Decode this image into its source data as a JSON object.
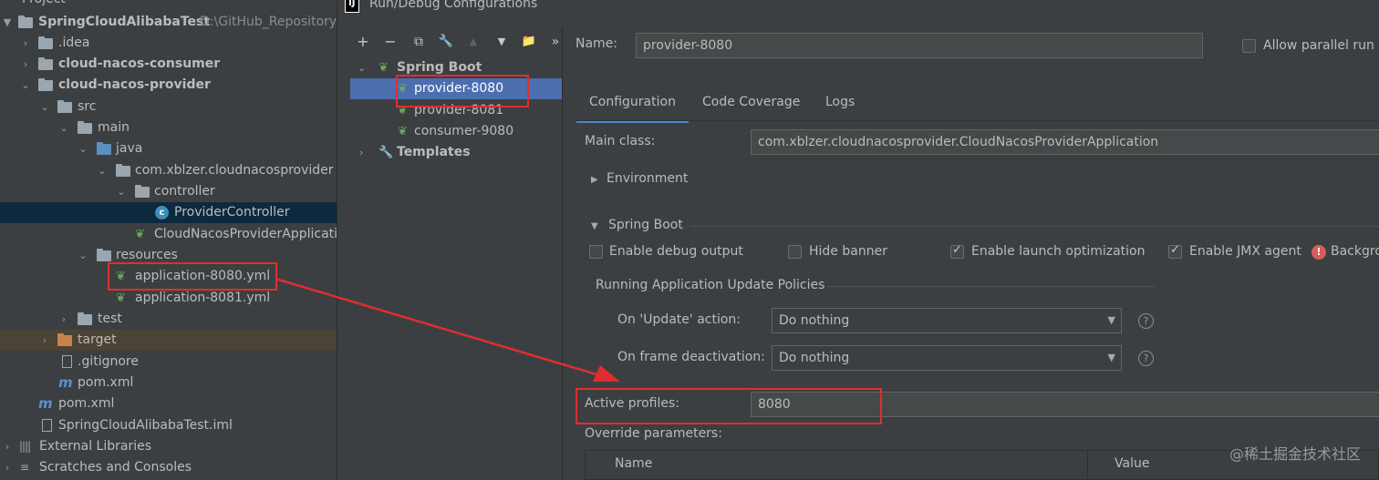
{
  "project_panel": {
    "header": "Project",
    "rows": [
      {
        "label": "SpringCloudAlibabaTest",
        "suffix": "D:\\GitHub_Repository"
      },
      {
        "label": ".idea"
      },
      {
        "label": "cloud-nacos-consumer"
      },
      {
        "label": "cloud-nacos-provider"
      },
      {
        "label": "src"
      },
      {
        "label": "main"
      },
      {
        "label": "java"
      },
      {
        "label": "com.xblzer.cloudnacosprovider"
      },
      {
        "label": "controller"
      },
      {
        "label": "ProviderController"
      },
      {
        "label": "CloudNacosProviderApplicati"
      },
      {
        "label": "resources"
      },
      {
        "label": "application-8080.yml"
      },
      {
        "label": "application-8081.yml"
      },
      {
        "label": "test"
      },
      {
        "label": "target"
      },
      {
        "label": ".gitignore"
      },
      {
        "label": "pom.xml"
      },
      {
        "label": "pom.xml"
      },
      {
        "label": "SpringCloudAlibabaTest.iml"
      },
      {
        "label": "External Libraries"
      },
      {
        "label": "Scratches and Consoles"
      }
    ],
    "icon_letters": {
      "class": "c",
      "maven": "m"
    }
  },
  "dialog": {
    "title": "Run/Debug Configurations",
    "logo_text": "IJ",
    "toolbar": {
      "add": "+",
      "remove": "−",
      "copy": "⧉",
      "wrench": "🔧",
      "up": "▲",
      "down": "▼",
      "folder": "📁",
      "more": "»"
    },
    "config_tree": {
      "group": "Spring Boot",
      "items": [
        "provider-8080",
        "provider-8081",
        "consumer-9080"
      ],
      "templates": "Templates"
    },
    "name_label": "Name:",
    "name_value": "provider-8080",
    "allow_parallel": "Allow parallel run",
    "tabs": [
      "Configuration",
      "Code Coverage",
      "Logs"
    ],
    "main_class_label": "Main class:",
    "main_class_value": "com.xblzer.cloudnacosprovider.CloudNacosProviderApplication",
    "environment": "Environment",
    "spring_boot_section": "Spring Boot",
    "checkboxes": [
      {
        "label": "Enable debug output",
        "checked": false
      },
      {
        "label": "Hide banner",
        "checked": false
      },
      {
        "label": "Enable launch optimization",
        "checked": true
      },
      {
        "label": "Enable JMX agent",
        "checked": true
      }
    ],
    "background_label": "Backgro",
    "policies_title": "Running Application Update Policies",
    "on_update_label": "On 'Update' action:",
    "on_update_value": "Do nothing",
    "on_frame_label": "On frame deactivation:",
    "on_frame_value": "Do nothing",
    "help_glyph": "?",
    "warn_glyph": "!",
    "active_profiles_label": "Active profiles:",
    "active_profiles_value": "8080",
    "override_label": "Override parameters:",
    "table_headers": [
      "Name",
      "Value"
    ]
  },
  "watermark": "@稀土掘金技术社区",
  "colors": {
    "selection": "#4b6eaf",
    "annotation_red": "#e02e2e",
    "panel_bg": "#3c3f41"
  }
}
